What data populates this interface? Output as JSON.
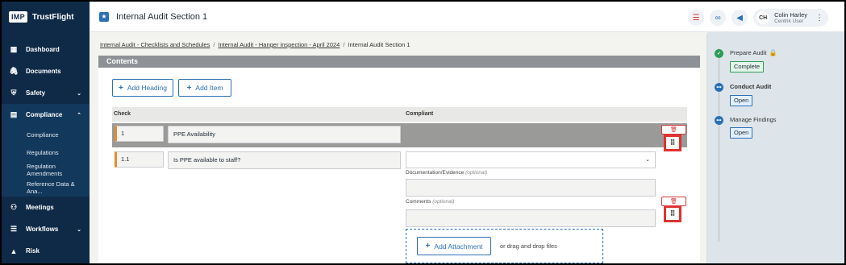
{
  "app": {
    "logo_text": "IMP",
    "name": "TrustFlight"
  },
  "sidebar": {
    "items": [
      {
        "label": "Dashboard",
        "icon": "dashboard-icon"
      },
      {
        "label": "Documents",
        "icon": "paperclip-icon"
      },
      {
        "label": "Safety",
        "icon": "shield-icon",
        "chevron": "⌄"
      },
      {
        "label": "Compliance",
        "icon": "document-icon",
        "chevron": "⌃"
      },
      {
        "label": "Meetings",
        "icon": "people-icon"
      },
      {
        "label": "Workflows",
        "icon": "workflow-icon",
        "chevron": "⌄"
      },
      {
        "label": "Risk",
        "icon": "warning-icon"
      }
    ],
    "compliance_sub": [
      "Compliance",
      "Regulations",
      "Regulation Amendments",
      "Reference Data & Ana..."
    ]
  },
  "header": {
    "title": "Internal Audit Section 1",
    "user": {
      "initials": "CH",
      "name": "Colin Harley",
      "role": "Centrik User"
    }
  },
  "breadcrumb": {
    "items": [
      "Internal Audit - Checklists and Schedules",
      "Internal Audit - Hanger inspection - April 2024",
      "Internal Audit Section 1"
    ],
    "separator": "/"
  },
  "contents": {
    "title": "Contents",
    "add_heading": "Add Heading",
    "add_item": "Add Item",
    "columns": {
      "check": "Check",
      "compliant": "Compliant"
    },
    "heading_row": {
      "number": "1",
      "text": "PPE Availability"
    },
    "item_row": {
      "number": "1.1",
      "text": "Is PPE available to staff?",
      "compliant_value": "",
      "documentation_label": "Documentation/Evidence",
      "comments_label": "Comments",
      "optional_text": "(optional)",
      "add_attachment": "Add Attachment",
      "drop_text": "or drag and drop files"
    }
  },
  "workflow": {
    "steps": [
      {
        "title": "Prepare Audit",
        "status": "Complete",
        "state": "done",
        "locked": true
      },
      {
        "title": "Conduct Audit",
        "status": "Open",
        "state": "current",
        "locked": false
      },
      {
        "title": "Manage Findings",
        "status": "Open",
        "state": "pending",
        "locked": false
      }
    ]
  },
  "colors": {
    "sidebar": "#0e2a47",
    "accent": "#2b6fb5",
    "danger": "#e0322f",
    "success": "#2e9c58"
  }
}
